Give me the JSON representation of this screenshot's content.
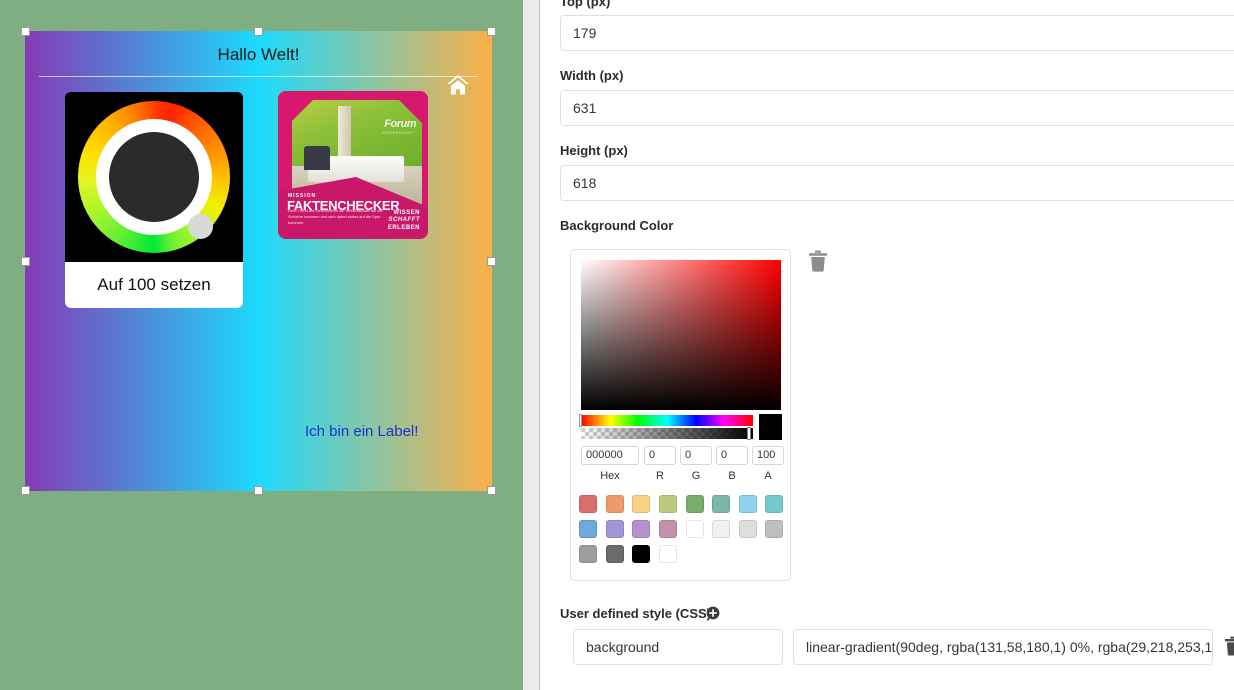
{
  "canvas": {
    "background_color": "#7fae82",
    "selected_frame": {
      "title": "Hallo Welt!",
      "label_text": "Ich bin ein Label!",
      "label_color": "#1f2fd0",
      "gradient_css": "linear-gradient(90deg, rgba(131,58,180,1) 0%, rgba(29,218,253,1) 50%, rgba(252,176,69,1) 100%)",
      "home_icon": "home-icon"
    },
    "gauge_widget": {
      "button_label": "Auf 100 setzen",
      "background": "#000000",
      "knob_color": "#d8d8d8"
    },
    "poster_card": {
      "mission": "MISSION",
      "headline": "FAKTENCHECKER",
      "blurb": "Dem Trend auf Geschichten der Wissenschaft auf die Schliche kommen und sich dabei selbst auf die Spur kommen.",
      "claim_line1": "WISSEN",
      "claim_line2": "SCHAFFT",
      "claim_line3": "ERLEBEN",
      "photo_text": "Forum",
      "photo_subtext": "WISSENSCHAFT",
      "frame_color": "#d6196f"
    }
  },
  "properties": {
    "fields": [
      {
        "label": "Top (px)",
        "value": "179"
      },
      {
        "label": "Width (px)",
        "value": "631"
      },
      {
        "label": "Height (px)",
        "value": "618"
      }
    ],
    "background_color": {
      "label": "Background Color",
      "delete_icon": "trash-icon",
      "hex": "000000",
      "r": "0",
      "g": "0",
      "b": "0",
      "a": "100",
      "captions": [
        "Hex",
        "R",
        "G",
        "B",
        "A"
      ],
      "preview_color": "#000000",
      "swatches": [
        "#d9706f",
        "#ef9a6a",
        "#fbd285",
        "#bdc97f",
        "#7aac6c",
        "#7bb8a9",
        "#8ed2f0",
        "#74c9cd",
        "#6ea8de",
        "#9f95d8",
        "#b78fce",
        "#c190ad",
        "#ffffff",
        "#f0f0f0",
        "#dedede",
        "#bfbfbf",
        "#9d9d9d",
        "#6b6b6b",
        "#000000",
        "#ffffff"
      ]
    },
    "user_defined_style": {
      "label": "User defined style (CSS)",
      "add_icon": "plus-circle-icon",
      "property_name": "background",
      "property_value": "linear-gradient(90deg, rgba(131,58,180,1) 0%, rgba(29,218,253,1",
      "delete_icon": "trash-icon"
    }
  }
}
